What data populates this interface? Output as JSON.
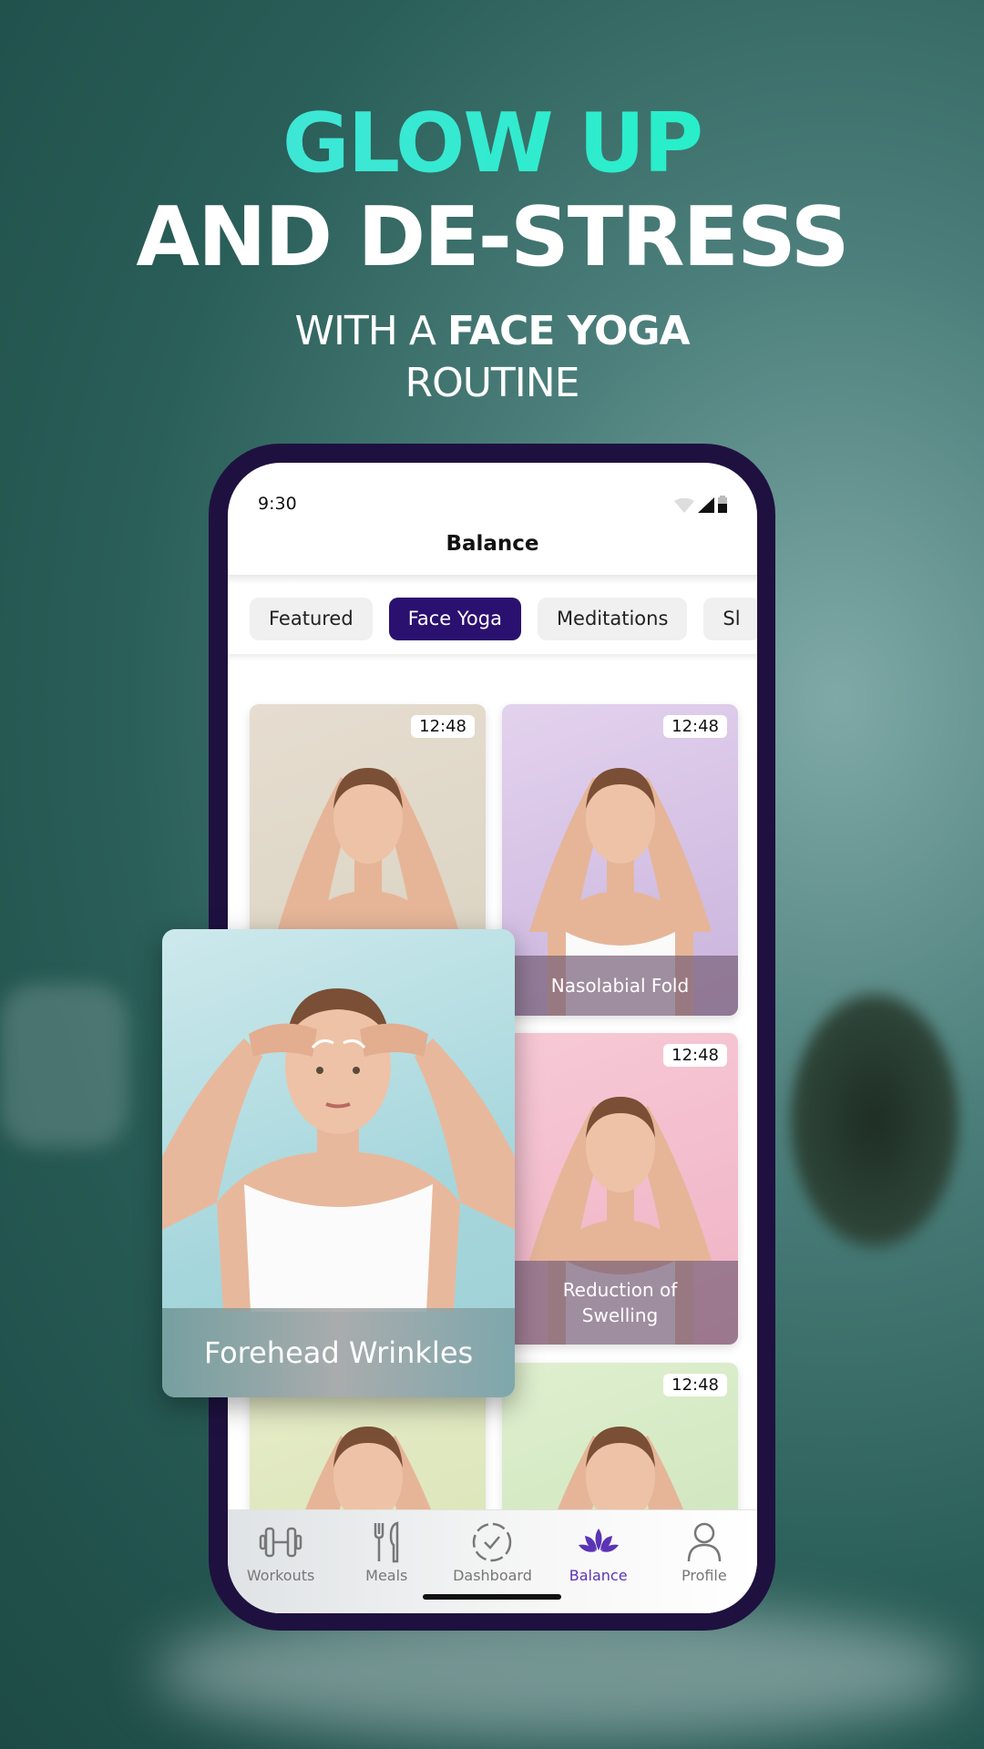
{
  "promo": {
    "line1": "GLOW UP",
    "line2": "AND DE-STRESS",
    "sub_pre": "WITH A ",
    "sub_bold": "FACE YOGA",
    "sub_line2": "ROUTINE"
  },
  "colors": {
    "accent": "#2a1170",
    "nav_active": "#5b33b5",
    "headline_gradient": [
      "#4fe0e0",
      "#17f5c0"
    ],
    "phone_frame": "#1e1140"
  },
  "status": {
    "time": "9:30",
    "icons": [
      "wifi-icon",
      "signal-icon",
      "battery-icon"
    ]
  },
  "header": {
    "title": "Balance"
  },
  "tabs": [
    {
      "label": "Featured"
    },
    {
      "label": "Face Yoga",
      "active": true
    },
    {
      "label": "Meditations"
    },
    {
      "label": "Sl"
    }
  ],
  "cards": [
    {
      "duration": "12:48",
      "label": "",
      "bg": [
        "#e6ddd0",
        "#d9d2c0"
      ]
    },
    {
      "duration": "12:48",
      "label": "Nasolabial Fold",
      "bg": [
        "#e3d2ee",
        "#c9b3dc"
      ]
    },
    {
      "duration": "",
      "label": "",
      "bg": [
        "#e8f0d8",
        "#d8e6c4"
      ]
    },
    {
      "duration": "12:48",
      "label": "Reduction of Swelling",
      "bg": [
        "#f7c9d6",
        "#efb2c4"
      ]
    },
    {
      "duration": "",
      "label": "",
      "bg": [
        "#e6ecc9",
        "#d7e2b2"
      ]
    },
    {
      "duration": "12:48",
      "label": "",
      "bg": [
        "#dfefcf",
        "#c8e2b6"
      ]
    }
  ],
  "featured_card": {
    "label": "Forehead Wrinkles"
  },
  "nav": [
    {
      "label": "Workouts",
      "icon": "dumbbell-icon"
    },
    {
      "label": "Meals",
      "icon": "fork-knife-icon"
    },
    {
      "label": "Dashboard",
      "icon": "check-circle-icon"
    },
    {
      "label": "Balance",
      "icon": "lotus-icon",
      "active": true
    },
    {
      "label": "Profile",
      "icon": "person-icon"
    }
  ]
}
